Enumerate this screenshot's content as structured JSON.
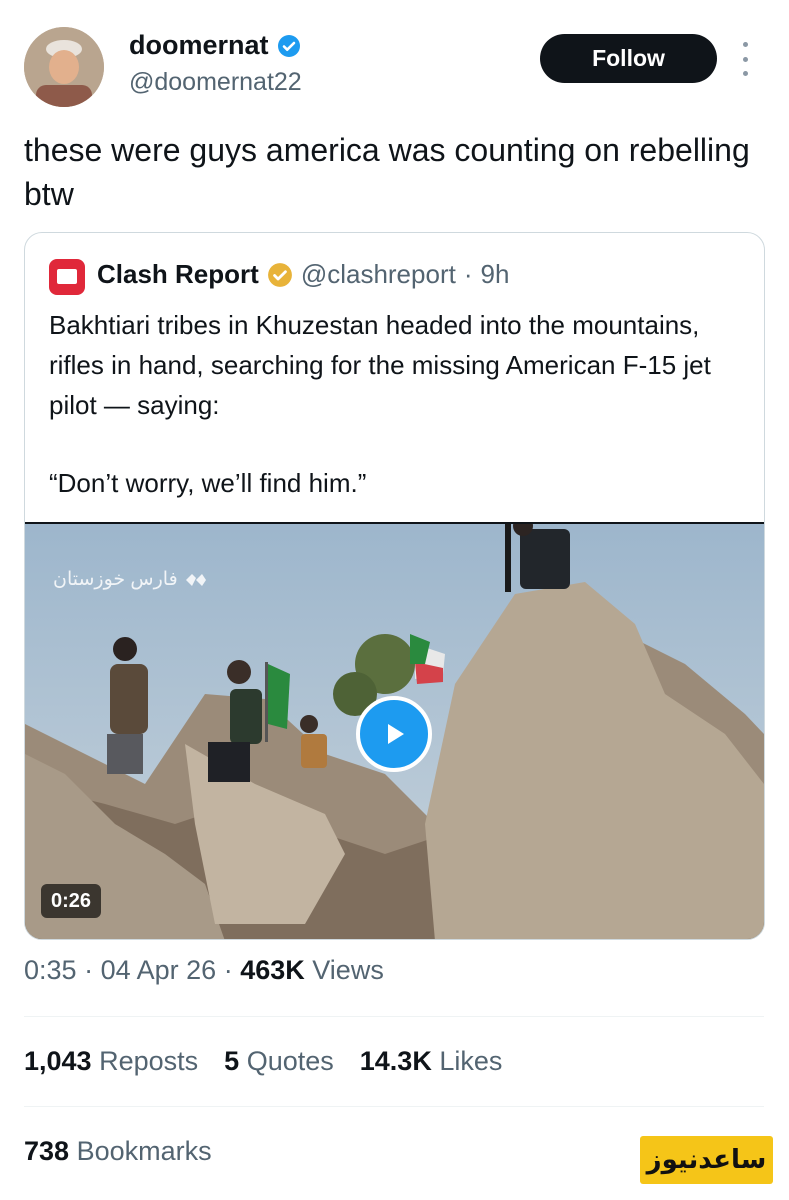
{
  "author": {
    "name": "doomernat",
    "handle": "@doomernat22",
    "verified_color": "#1d9bf0",
    "follow_label": "Follow"
  },
  "tweet": {
    "text": "these were guys america was counting on rebelling btw"
  },
  "quoted": {
    "name": "Clash Report",
    "handle": "@clashreport",
    "separator": "·",
    "age": "9h",
    "verified_color": "#e8b339",
    "body": "Bakhtiari tribes in Khuzestan headed into the mountains, rifles in hand, searching for the missing American F-15 jet pilot — saying:",
    "quote": "“Don’t worry, we’ll find him.”",
    "video": {
      "duration": "0:26",
      "watermark": "فارس خوزستان"
    }
  },
  "meta": {
    "time": "0:35",
    "sep1": "·",
    "date": "04 Apr 26",
    "sep2": "·",
    "views_count": "463K",
    "views_label": "Views"
  },
  "stats": {
    "reposts_count": "1,043",
    "reposts_label": "Reposts",
    "quotes_count": "5",
    "quotes_label": "Quotes",
    "likes_count": "14.3K",
    "likes_label": "Likes",
    "bookmarks_count": "738",
    "bookmarks_label": "Bookmarks"
  },
  "site_logo_text": "ساعدنیوز"
}
